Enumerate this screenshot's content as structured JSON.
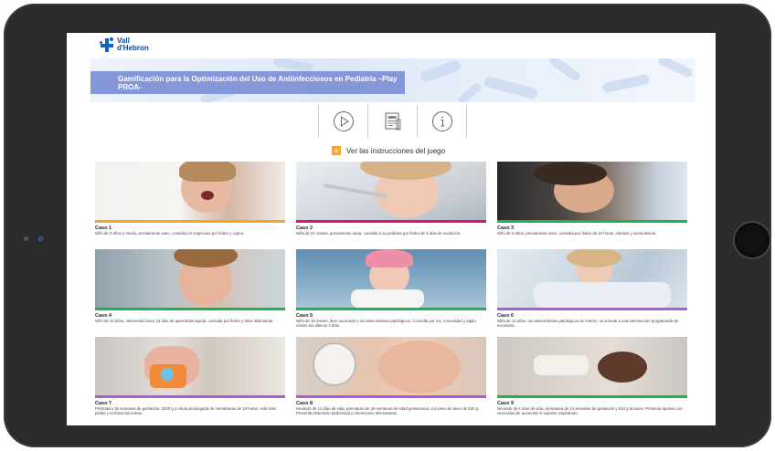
{
  "header": {
    "logo_line1": "Vall",
    "logo_line2": "d'Hebron",
    "title": "Gamificación para la Optimización del Uso de Antiinfecciosos en Pediatría –Play PROA-"
  },
  "toolbar": {
    "icons": [
      "play-icon",
      "document-icon",
      "info-icon"
    ]
  },
  "instructions_label": "Ver las instrucciones del juego",
  "colors": {
    "orange": "#f5a623",
    "pink": "#e0107a",
    "green": "#22b24c",
    "purple": "#b05ad9",
    "banner": "#8497d8"
  },
  "cases": [
    {
      "title": "Caso 1",
      "desc": "Niño de 3 años y medio, previamente sano, consulta en Urgencias por fiebre y cojera.",
      "bar": "#f5a623"
    },
    {
      "title": "Caso 2",
      "desc": "Niña de 21 meses, previamente sana, consulta a su pediatra por fiebre de 3 días de evolución.",
      "bar": "#e0107a"
    },
    {
      "title": "Caso 3",
      "desc": "Niño de 3 años, previamente sano, consulta por fiebre de 24 horas, vómitos y somnolencia.",
      "bar": "#22b24c"
    },
    {
      "title": "Caso 4",
      "desc": "Niño de 10 años, intervenido hace 10 días de apendicitis aguda, consulta por fiebre y dolor abdominal.",
      "bar": "#22b24c"
    },
    {
      "title": "Caso 5",
      "desc": "Niño de 18 meses, bien vacunado y sin antecedentes patológicos. Consulta por tos, mucosidad y algún vómito los últimos 4 días.",
      "bar": "#22b24c"
    },
    {
      "title": "Caso 6",
      "desc": "Niña de 12 años, sin antecedentes patológicos de interés, se somete a una intervención programada de escoliosis.",
      "bar": "#b05ad9"
    },
    {
      "title": "Caso 7",
      "desc": "Prematuro 36 semanas de gestación, 2020 g y rotura prolongada de membranas de 19 horas, está más pálido y rechaza las tomas.",
      "bar": "#b05ad9"
    },
    {
      "title": "Caso 8",
      "desc": "Neonato de 14 días de vida, prematuro de 29 semanas de edad gestacional, con peso al nacer de 620 g. Presenta distensión abdominal y retenciones alimentarias.",
      "bar": "#b05ad9"
    },
    {
      "title": "Caso 9",
      "desc": "Neonato de 6 días de vida, prematura de 24 semanas de gestación y 510 g al nacer. Presenta apneas con necesidad de aumentar el soporte respiratorio.",
      "bar": "#22b24c"
    }
  ]
}
